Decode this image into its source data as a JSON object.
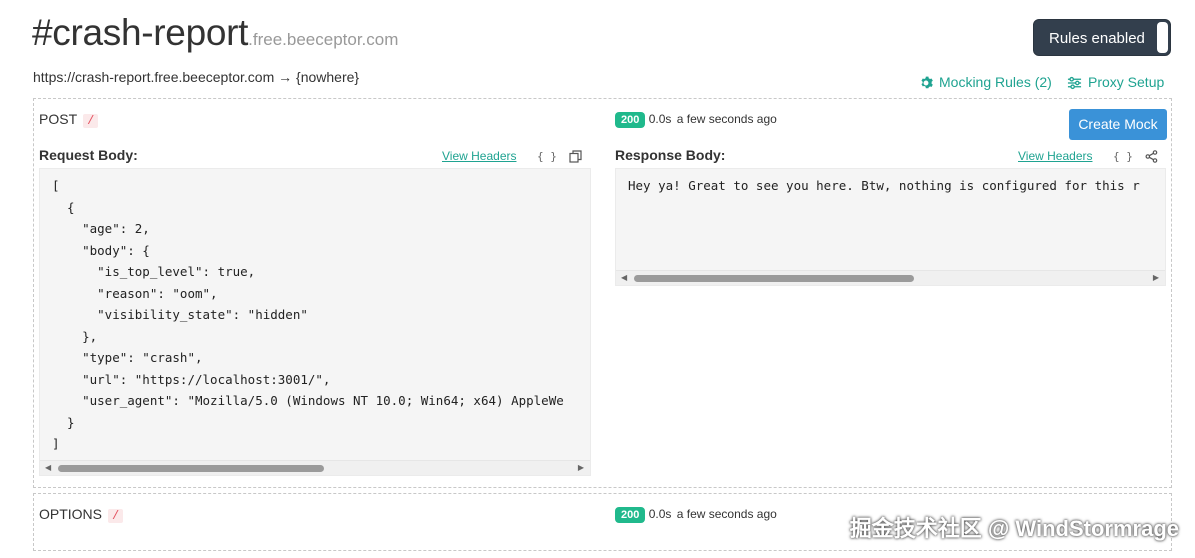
{
  "header": {
    "endpoint_name": "#crash-report",
    "endpoint_domain": ".free.beeceptor.com",
    "url": "https://crash-report.free.beeceptor.com",
    "arrow": "→",
    "target": "{nowhere}",
    "rules_toggle_label": "Rules enabled",
    "mocking_rules_label": "Mocking Rules (2)",
    "proxy_setup_label": "Proxy Setup"
  },
  "requests": [
    {
      "method": "POST",
      "path": "/",
      "status": "200",
      "duration": "0.0s",
      "time_ago": "a few seconds ago",
      "create_mock_label": "Create Mock",
      "request_body_label": "Request Body:",
      "response_body_label": "Response Body:",
      "view_headers_label": "View Headers",
      "braces_label": "{ }",
      "request_body": "[\n  {\n    \"age\": 2,\n    \"body\": {\n      \"is_top_level\": true,\n      \"reason\": \"oom\",\n      \"visibility_state\": \"hidden\"\n    },\n    \"type\": \"crash\",\n    \"url\": \"https://localhost:3001/\",\n    \"user_agent\": \"Mozilla/5.0 (Windows NT 10.0; Win64; x64) AppleWe\n  }\n]",
      "response_body": "Hey ya! Great to see you here. Btw, nothing is configured for this r"
    },
    {
      "method": "OPTIONS",
      "path": "/",
      "status": "200",
      "duration": "0.0s",
      "time_ago": "a few seconds ago"
    }
  ],
  "watermark": "掘金技术社区 @ WindStormrage",
  "colors": {
    "accent_teal": "#1fa391",
    "badge_green": "#20b98c",
    "button_blue": "#3a92d8",
    "toggle_dark": "#333f4d"
  }
}
